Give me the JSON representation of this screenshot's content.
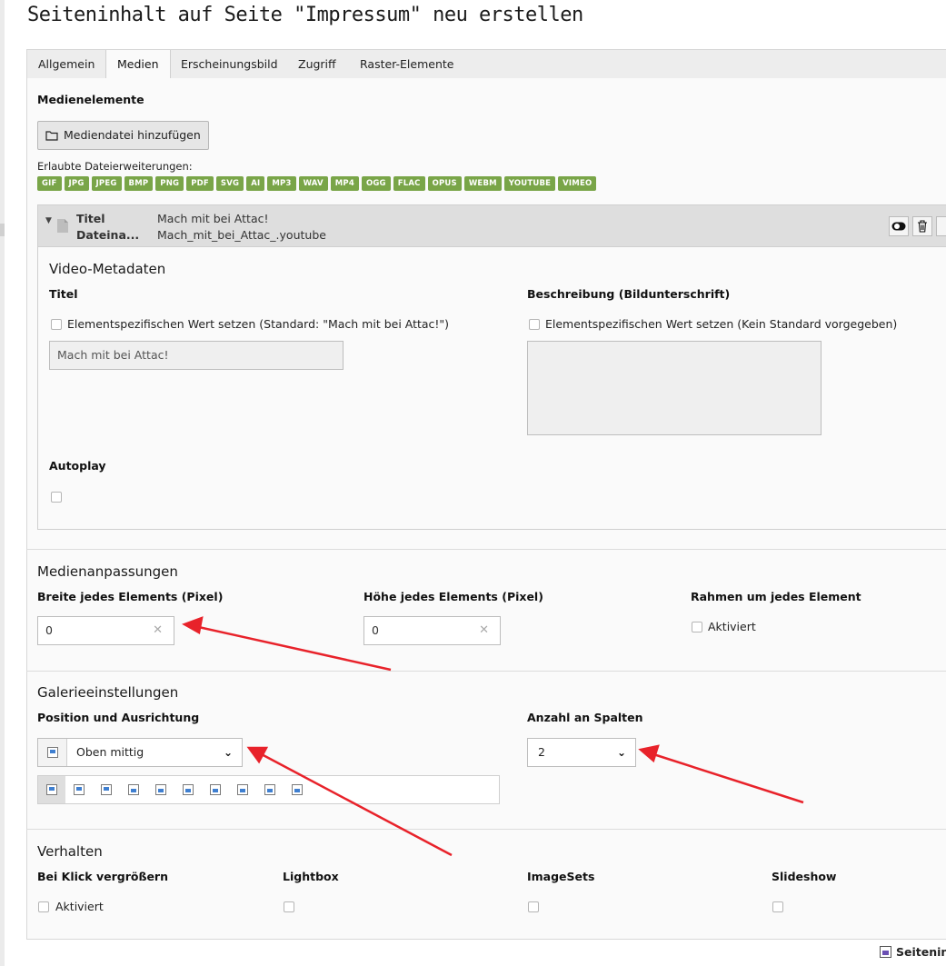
{
  "page": {
    "title": "Seiteninhalt auf Seite \"Impressum\" neu erstellen"
  },
  "tabs": [
    {
      "label": "Allgemein"
    },
    {
      "label": "Medien"
    },
    {
      "label": "Erscheinungsbild"
    },
    {
      "label": "Zugriff"
    },
    {
      "label": "Raster-Elemente"
    }
  ],
  "active_tab": "Medien",
  "media": {
    "heading": "Medienelemente",
    "add_button": "Mediendatei hinzufügen",
    "allowed_label": "Erlaubte Dateierweiterungen:",
    "extensions": [
      "GIF",
      "JPG",
      "JPEG",
      "BMP",
      "PNG",
      "PDF",
      "SVG",
      "AI",
      "MP3",
      "WAV",
      "MP4",
      "OGG",
      "FLAC",
      "OPUS",
      "WEBM",
      "YOUTUBE",
      "VIMEO"
    ],
    "badge_color": "#79a548"
  },
  "file_item": {
    "title_label": "Titel",
    "title_value": "Mach mit bei Attac!",
    "filename_label": "Dateina...",
    "filename_value": "Mach_mit_bei_Attac_.youtube"
  },
  "video_meta": {
    "heading": "Video-Metadaten",
    "title_label": "Titel",
    "title_override": "Elementspezifischen Wert setzen (Standard: \"Mach mit bei Attac!\")",
    "title_placeholder": "Mach mit bei Attac!",
    "desc_label": "Beschreibung (Bildunterschrift)",
    "desc_override": "Elementspezifischen Wert setzen (Kein Standard vorgegeben)",
    "autoplay_label": "Autoplay"
  },
  "adjustments": {
    "heading": "Medienanpassungen",
    "width_label": "Breite jedes Elements (Pixel)",
    "width_value": "0",
    "height_label": "Höhe jedes Elements (Pixel)",
    "height_value": "0",
    "border_label": "Rahmen um jedes Element",
    "border_checkbox": "Aktiviert"
  },
  "gallery": {
    "heading": "Galerieeinstellungen",
    "position_label": "Position und Ausrichtung",
    "position_value": "Oben mittig",
    "columns_label": "Anzahl an Spalten",
    "columns_value": "2"
  },
  "behaviour": {
    "heading": "Verhalten",
    "zoom_label": "Bei Klick vergrößern",
    "zoom_checkbox": "Aktiviert",
    "lightbox_label": "Lightbox",
    "imagesets_label": "ImageSets",
    "slideshow_label": "Slideshow"
  },
  "footer": {
    "partial_label": "Seitenin"
  },
  "annotation": {
    "arrow_color": "#e8222a"
  }
}
